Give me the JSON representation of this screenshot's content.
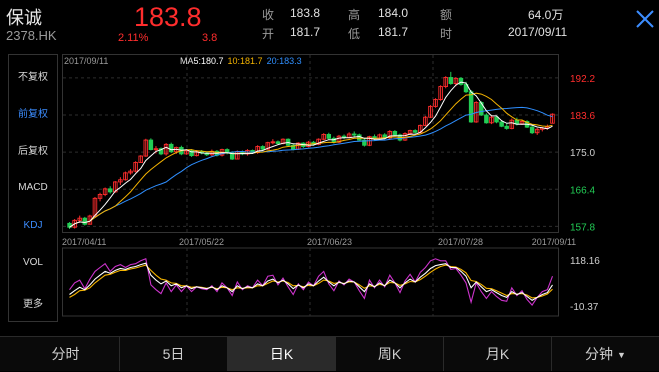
{
  "header": {
    "name": "保诚",
    "code": "2378.HK",
    "price": "183.8",
    "change_pct": "2.11%",
    "change": "3.8",
    "stats": [
      {
        "label": "收",
        "value": "183.8"
      },
      {
        "label": "高",
        "value": "184.0"
      },
      {
        "label": "额",
        "value": "64.0万"
      },
      {
        "label": "开",
        "value": "181.7"
      },
      {
        "label": "低",
        "value": "181.7"
      },
      {
        "label": "时",
        "value": "2017/09/11"
      }
    ]
  },
  "sidebar": {
    "items": [
      {
        "label": "不复权",
        "active": false
      },
      {
        "label": "前复权",
        "active": true
      },
      {
        "label": "后复权",
        "active": false
      },
      {
        "label": "MACD",
        "active": false
      },
      {
        "label": "KDJ",
        "active": true
      },
      {
        "label": "VOL",
        "active": false
      },
      {
        "label": "更多",
        "active": false
      }
    ]
  },
  "chart_data": {
    "type": "candlestick",
    "ma_legend": {
      "date": "2017/09/11",
      "prefix": "MA",
      "ma5": "5:180.7",
      "ma10": "10:181.7",
      "ma20": "20:183.3"
    },
    "price_ticks": [
      "192.2",
      "183.6",
      "175.0",
      "166.4",
      "157.8"
    ],
    "price_range": [
      156.5,
      194.5
    ],
    "date_ticks": [
      "2017/04/11",
      "2017/05/22",
      "2017/06/23",
      "2017/07/28",
      "2017/09/11"
    ],
    "kdj_ticks": [
      "118.16",
      "-10.37"
    ],
    "kdj_range": [
      -10.37,
      118.16
    ],
    "candles": [
      [
        158.5,
        158.8,
        157.2,
        157.6
      ],
      [
        157.6,
        159.5,
        157.3,
        159.2
      ],
      [
        159.2,
        160.3,
        158.6,
        159.7
      ],
      [
        159.7,
        160.0,
        158.0,
        158.3
      ],
      [
        158.3,
        160.5,
        158.2,
        160.2
      ],
      [
        160.2,
        164.6,
        160.0,
        164.3
      ],
      [
        164.3,
        165.6,
        163.6,
        165.2
      ],
      [
        165.2,
        166.8,
        164.8,
        166.5
      ],
      [
        166.5,
        167.1,
        165.4,
        165.8
      ],
      [
        165.8,
        168.3,
        165.6,
        168.1
      ],
      [
        168.1,
        169.2,
        167.4,
        168.6
      ],
      [
        168.6,
        170.5,
        168.4,
        170.2
      ],
      [
        170.2,
        171.1,
        169.8,
        170.6
      ],
      [
        170.6,
        172.9,
        170.3,
        172.6
      ],
      [
        172.6,
        174.3,
        172.5,
        174.1
      ],
      [
        174.1,
        178.1,
        173.9,
        177.8
      ],
      [
        177.8,
        178.2,
        175.4,
        175.6
      ],
      [
        175.6,
        176.4,
        174.7,
        175.8
      ],
      [
        175.8,
        176.1,
        174.3,
        174.6
      ],
      [
        174.6,
        177.1,
        174.2,
        176.8
      ],
      [
        176.8,
        177.2,
        174.8,
        175.1
      ],
      [
        175.1,
        176.3,
        174.6,
        176.1
      ],
      [
        176.1,
        176.5,
        174.3,
        174.6
      ],
      [
        174.6,
        175.6,
        174.4,
        175.3
      ],
      [
        175.3,
        175.7,
        173.9,
        174.2
      ],
      [
        174.2,
        175.5,
        174.0,
        175.1
      ],
      [
        175.1,
        175.5,
        174.5,
        174.8
      ],
      [
        174.8,
        175.1,
        174.1,
        174.4
      ],
      [
        174.4,
        175.6,
        174.1,
        175.2
      ],
      [
        175.2,
        175.5,
        174.0,
        174.3
      ],
      [
        174.3,
        175.8,
        174.0,
        175.6
      ],
      [
        175.6,
        175.9,
        174.5,
        174.8
      ],
      [
        174.8,
        175.2,
        173.2,
        173.4
      ],
      [
        173.4,
        175.4,
        173.3,
        175.1
      ],
      [
        175.1,
        175.4,
        174.3,
        174.6
      ],
      [
        174.6,
        175.7,
        174.2,
        175.4
      ],
      [
        175.4,
        175.6,
        174.6,
        174.9
      ],
      [
        174.9,
        176.6,
        174.6,
        176.3
      ],
      [
        176.3,
        176.6,
        175.4,
        175.7
      ],
      [
        175.7,
        177.4,
        175.5,
        177.2
      ],
      [
        177.2,
        178.0,
        176.8,
        177.4
      ],
      [
        177.4,
        177.7,
        176.7,
        177.0
      ],
      [
        177.0,
        178.2,
        176.8,
        178.0
      ],
      [
        178.0,
        178.2,
        176.3,
        176.6
      ],
      [
        176.6,
        177.0,
        175.4,
        175.7
      ],
      [
        175.7,
        177.3,
        175.5,
        177.1
      ],
      [
        177.1,
        177.3,
        176.0,
        176.3
      ],
      [
        176.3,
        177.6,
        176.1,
        177.3
      ],
      [
        177.3,
        177.6,
        176.5,
        176.8
      ],
      [
        176.8,
        178.2,
        176.6,
        178.0
      ],
      [
        178.0,
        179.4,
        177.8,
        179.1
      ],
      [
        179.1,
        179.5,
        177.9,
        178.2
      ],
      [
        178.2,
        178.6,
        177.0,
        177.3
      ],
      [
        177.3,
        179.0,
        177.1,
        178.7
      ],
      [
        178.7,
        179.1,
        178.0,
        178.4
      ],
      [
        178.4,
        179.6,
        178.2,
        179.2
      ],
      [
        179.2,
        179.8,
        178.6,
        179.0
      ],
      [
        179.0,
        179.3,
        177.6,
        177.8
      ],
      [
        177.8,
        178.1,
        176.3,
        176.6
      ],
      [
        176.6,
        178.8,
        176.4,
        178.6
      ],
      [
        178.6,
        179.1,
        177.7,
        178.0
      ],
      [
        178.0,
        179.3,
        177.8,
        179.0
      ],
      [
        179.0,
        179.4,
        178.0,
        178.3
      ],
      [
        178.3,
        180.1,
        178.0,
        179.8
      ],
      [
        179.8,
        180.1,
        178.8,
        179.0
      ],
      [
        179.0,
        179.3,
        177.5,
        177.8
      ],
      [
        177.8,
        179.6,
        177.6,
        179.3
      ],
      [
        179.3,
        180.2,
        179.0,
        180.0
      ],
      [
        180.0,
        180.3,
        179.3,
        179.6
      ],
      [
        179.6,
        181.4,
        179.4,
        181.2
      ],
      [
        181.2,
        183.4,
        181.0,
        183.1
      ],
      [
        183.1,
        185.9,
        182.9,
        185.6
      ],
      [
        185.6,
        187.5,
        185.3,
        187.2
      ],
      [
        187.2,
        190.5,
        186.9,
        190.2
      ],
      [
        190.2,
        192.6,
        189.8,
        192.3
      ],
      [
        192.3,
        193.6,
        190.6,
        190.9
      ],
      [
        190.9,
        192.4,
        190.3,
        192.1
      ],
      [
        192.1,
        192.4,
        190.4,
        190.7
      ],
      [
        190.7,
        191.3,
        188.7,
        189.0
      ],
      [
        189.0,
        189.4,
        181.8,
        182.0
      ],
      [
        182.0,
        186.8,
        181.8,
        186.5
      ],
      [
        186.5,
        186.8,
        183.4,
        183.6
      ],
      [
        183.6,
        184.0,
        181.6,
        181.8
      ],
      [
        181.8,
        183.4,
        181.5,
        183.1
      ],
      [
        183.1,
        183.5,
        181.7,
        182.0
      ],
      [
        182.0,
        182.4,
        180.8,
        181.0
      ],
      [
        181.0,
        181.6,
        180.2,
        180.5
      ],
      [
        180.5,
        182.8,
        180.3,
        182.4
      ],
      [
        182.4,
        183.0,
        181.2,
        181.5
      ],
      [
        181.5,
        182.5,
        181.3,
        182.1
      ],
      [
        182.1,
        182.4,
        180.6,
        180.8
      ],
      [
        180.8,
        181.2,
        179.2,
        179.5
      ],
      [
        179.5,
        180.6,
        179.0,
        180.3
      ],
      [
        180.3,
        180.8,
        179.8,
        180.6
      ],
      [
        180.6,
        181.4,
        180.2,
        180.9
      ],
      [
        181.7,
        184.0,
        181.7,
        183.8
      ]
    ],
    "kdj": {
      "K": [
        30,
        38,
        45,
        40,
        50,
        62,
        70,
        78,
        74,
        80,
        84,
        82,
        86,
        88,
        92,
        95,
        70,
        60,
        52,
        58,
        48,
        52,
        44,
        48,
        42,
        46,
        44,
        42,
        46,
        40,
        48,
        44,
        36,
        48,
        42,
        46,
        44,
        52,
        48,
        58,
        62,
        54,
        60,
        52,
        42,
        50,
        44,
        52,
        48,
        58,
        66,
        56,
        48,
        56,
        52,
        58,
        56,
        46,
        36,
        52,
        46,
        54,
        48,
        60,
        54,
        44,
        54,
        62,
        56,
        66,
        74,
        84,
        90,
        92,
        94,
        86,
        86,
        78,
        68,
        44,
        56,
        46,
        36,
        40,
        34,
        28,
        24,
        36,
        30,
        34,
        26,
        18,
        24,
        30,
        34,
        50
      ],
      "D": [
        24,
        30,
        38,
        39,
        44,
        54,
        62,
        70,
        72,
        76,
        80,
        80,
        83,
        85,
        88,
        91,
        80,
        70,
        62,
        60,
        54,
        53,
        48,
        48,
        45,
        46,
        45,
        43,
        45,
        42,
        45,
        44,
        40,
        44,
        43,
        44,
        44,
        48,
        48,
        53,
        58,
        56,
        58,
        55,
        48,
        49,
        46,
        49,
        48,
        53,
        60,
        58,
        53,
        55,
        53,
        56,
        56,
        50,
        43,
        48,
        47,
        51,
        49,
        55,
        54,
        49,
        52,
        57,
        56,
        61,
        68,
        76,
        83,
        88,
        91,
        88,
        87,
        82,
        75,
        59,
        57,
        51,
        43,
        42,
        38,
        33,
        28,
        32,
        31,
        32,
        29,
        23,
        24,
        27,
        31,
        41
      ],
      "J": [
        40,
        54,
        60,
        42,
        62,
        78,
        86,
        94,
        78,
        88,
        92,
        86,
        92,
        94,
        100,
        104,
        50,
        40,
        32,
        54,
        36,
        50,
        36,
        48,
        36,
        46,
        42,
        40,
        48,
        36,
        54,
        44,
        28,
        56,
        40,
        48,
        44,
        60,
        48,
        68,
        70,
        50,
        64,
        46,
        30,
        52,
        40,
        56,
        48,
        68,
        78,
        52,
        38,
        58,
        50,
        62,
        56,
        38,
        22,
        60,
        44,
        60,
        46,
        70,
        54,
        34,
        58,
        72,
        56,
        76,
        86,
        100,
        104,
        100,
        100,
        82,
        84,
        70,
        54,
        14,
        54,
        36,
        22,
        36,
        26,
        18,
        16,
        44,
        28,
        38,
        20,
        8,
        24,
        36,
        40,
        68
      ]
    }
  },
  "tabs": [
    {
      "label": "分时",
      "active": false,
      "caret": ""
    },
    {
      "label": "5日",
      "active": false,
      "caret": ""
    },
    {
      "label": "日K",
      "active": true,
      "caret": ""
    },
    {
      "label": "周K",
      "active": false,
      "caret": ""
    },
    {
      "label": "月K",
      "active": false,
      "caret": ""
    },
    {
      "label": "分钟",
      "active": false,
      "caret": "▼"
    }
  ],
  "colors": {
    "up": "#ff2d2d",
    "down": "#22cc55",
    "accent": "#3c8dff",
    "ma5": "#ffffff",
    "ma10": "#f5b400",
    "ma20": "#2f8fff",
    "kdj_k": "#ffffff",
    "kdj_d": "#f5b400",
    "kdj_j": "#cc33cc"
  }
}
